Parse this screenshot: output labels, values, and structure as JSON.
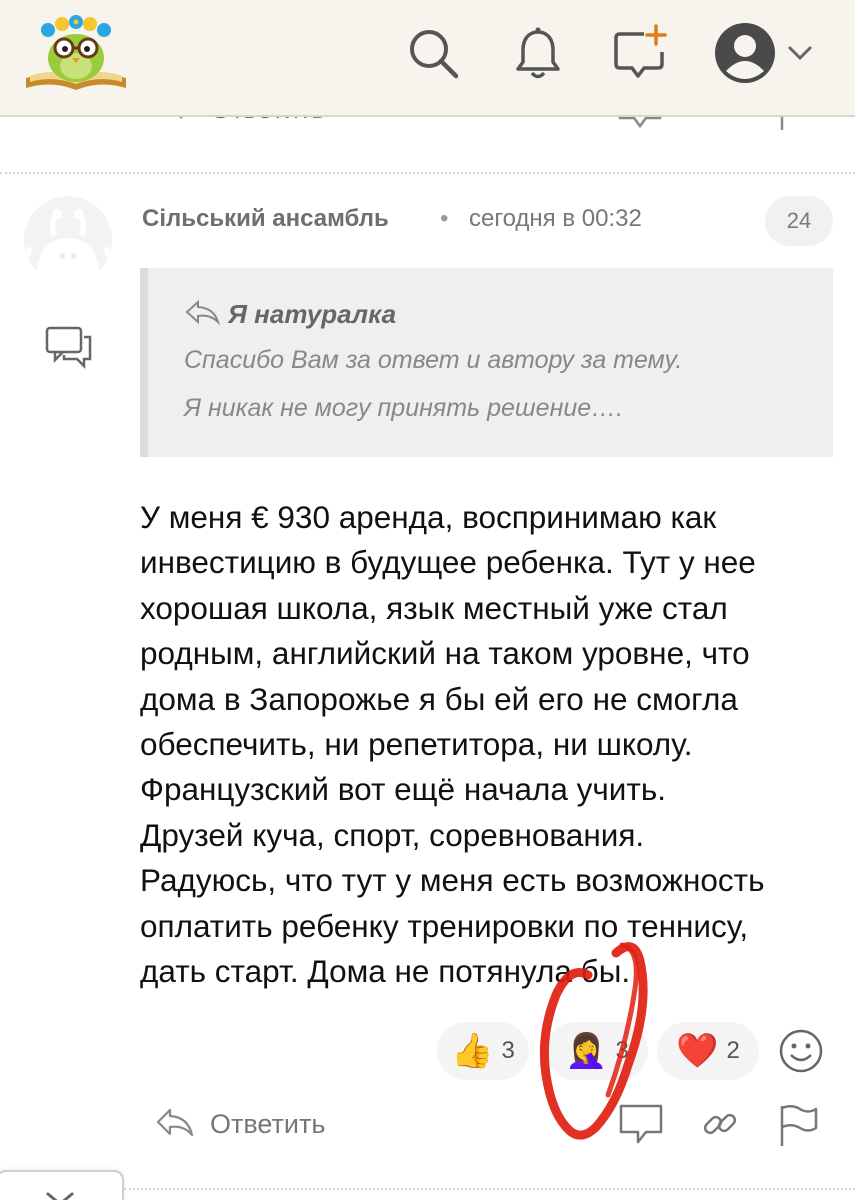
{
  "header": {
    "logo": "owl-on-book-logo",
    "icons": [
      "search-icon",
      "bell-icon",
      "new-message-icon",
      "user-avatar-icon",
      "chevron-down-icon"
    ]
  },
  "previous_post": {
    "reply_label": "Ответить"
  },
  "post": {
    "author": "Сільський ансамбль",
    "separator_dot": "•",
    "date": "сегодня в 00:32",
    "number": "24",
    "quote": {
      "author": "Я натуралка",
      "lines": [
        "Спасибо Вам за ответ и автору за тему.",
        "Я никак не могу принять решение…."
      ]
    },
    "body_lines": [
      "У меня € 930 аренда, воспринимаю как",
      "инвестицию в будущее ребенка. Тут у нее",
      "хорошая школа, язык местный уже стал",
      "родным, английский на таком уровне, что",
      "дома в Запорожье я бы ей его не смогла",
      "обеспечить, ни репетитора, ни школу.",
      "Французский вот ещё начала учить.",
      "Друзей куча, спорт, соревнования.",
      "Радуюсь, что тут у меня есть возможность",
      "оплатить ребенку тренировки по теннису,",
      "дать старт. Дома не потянула бы."
    ],
    "reactions": [
      {
        "emoji": "👍",
        "count": "3",
        "name": "thumbs-up"
      },
      {
        "emoji": "🤦‍♀️",
        "count": "3",
        "name": "facepalm"
      },
      {
        "emoji": "❤️",
        "count": "2",
        "name": "heart"
      }
    ],
    "actions": {
      "reply_label": "Ответить"
    }
  },
  "colors": {
    "header_bg": "#f6f4ec",
    "quote_bg": "#efefef",
    "reaction_bg": "#f4f4f4",
    "annotation_red": "#e0200f"
  }
}
